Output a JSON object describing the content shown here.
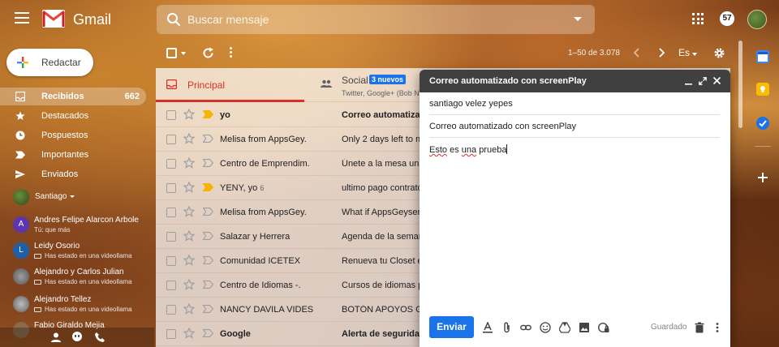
{
  "app": {
    "name": "Gmail",
    "notification_count": "57"
  },
  "search": {
    "placeholder": "Buscar mensaje"
  },
  "compose_button": {
    "label": "Redactar"
  },
  "nav": {
    "items": [
      {
        "label": "Recibidos",
        "count": "662",
        "active": true
      },
      {
        "label": "Destacados",
        "count": ""
      },
      {
        "label": "Pospuestos",
        "count": ""
      },
      {
        "label": "Importantes",
        "count": ""
      },
      {
        "label": "Enviados",
        "count": ""
      }
    ]
  },
  "chat": {
    "me": "Santiago",
    "contacts": [
      {
        "name": "Andres Felipe Alarcon Arbole",
        "status": "Tú: que más",
        "initial": "A",
        "color": "#5e35b1"
      },
      {
        "name": "Leidy Osorio",
        "status": "Has estado en una videollama",
        "initial": "L",
        "color": "#1e5fa8"
      },
      {
        "name": "Alejandro y Carlos Julian",
        "status": "Has estado en una videollama",
        "initial": "",
        "color": "#6a6a6a"
      },
      {
        "name": "Alejandro Tellez",
        "status": "Has estado en una videollama",
        "initial": "",
        "color": "#7a7a7a"
      },
      {
        "name": "Fabio Giraldo Mejia",
        "status": "",
        "initial": "",
        "color": "#8a6a4a"
      }
    ]
  },
  "toolbar": {
    "pager": "1–50 de 3.078",
    "language": "Es"
  },
  "tabs": {
    "primary": "Principal",
    "social": "Social",
    "social_badge": "3 nuevos",
    "social_snippet": "Twitter, Google+ (Bob N"
  },
  "emails": [
    {
      "sender": "yo",
      "count": "",
      "subject": "Correo automatizado",
      "unread": true,
      "important": true
    },
    {
      "sender": "Melisa from AppsGey.",
      "count": "",
      "subject": "Only 2 days left to m",
      "unread": false,
      "important": false
    },
    {
      "sender": "Centro de Emprendim.",
      "count": "",
      "subject": "Únete a la mesa univ",
      "unread": false,
      "important": false
    },
    {
      "sender": "YENY, yo",
      "count": "6",
      "subject": "ultimo pago contrato",
      "unread": false,
      "important": true
    },
    {
      "sender": "Melisa from AppsGey.",
      "count": "",
      "subject": "What if AppsGeyser",
      "unread": false,
      "important": false
    },
    {
      "sender": "Salazar y Herrera",
      "count": "",
      "subject": "Agenda de la seman",
      "unread": false,
      "important": false
    },
    {
      "sender": "Comunidad ICETEX",
      "count": "",
      "subject": "Renueva tu Closet e",
      "unread": false,
      "important": false
    },
    {
      "sender": "Centro de Idiomas -.",
      "count": "",
      "subject": "Cursos de idiomas p",
      "unread": false,
      "important": false
    },
    {
      "sender": "NANCY DAVILA VIDES",
      "count": "",
      "subject": "BOTÓN APOYOS GE",
      "unread": false,
      "important": false
    },
    {
      "sender": "Google",
      "count": "",
      "subject": "Alerta de seguridad",
      "unread": true,
      "important": false
    }
  ],
  "compose": {
    "title": "Correo automatizado con screenPlay",
    "to": "santiago velez yepes",
    "subject": "Correo automatizado con screenPlay",
    "body_words": [
      "Esto",
      "es",
      "una",
      "prueba"
    ],
    "send_label": "Enviar",
    "saved_label": "Guardado"
  },
  "colors": {
    "accent_red": "#d93025",
    "send_blue": "#1a73e8",
    "compose_header": "#404040",
    "important_yellow": "#f4b400"
  },
  "icons": {
    "header": [
      "menu-icon",
      "gmail-logo",
      "search-icon",
      "apps-icon",
      "account-avatar"
    ],
    "toolbar": [
      "select-checkbox",
      "refresh-icon",
      "more-icon",
      "chevron-left-icon",
      "chevron-right-icon",
      "settings-icon"
    ],
    "compose_tools": [
      "format-text-icon",
      "attach-icon",
      "link-icon",
      "emoji-icon",
      "drive-icon",
      "photo-icon",
      "confidential-icon",
      "delete-icon",
      "more-options-icon"
    ],
    "side_panel": [
      "calendar-icon",
      "keep-icon",
      "tasks-icon",
      "add-icon"
    ]
  }
}
